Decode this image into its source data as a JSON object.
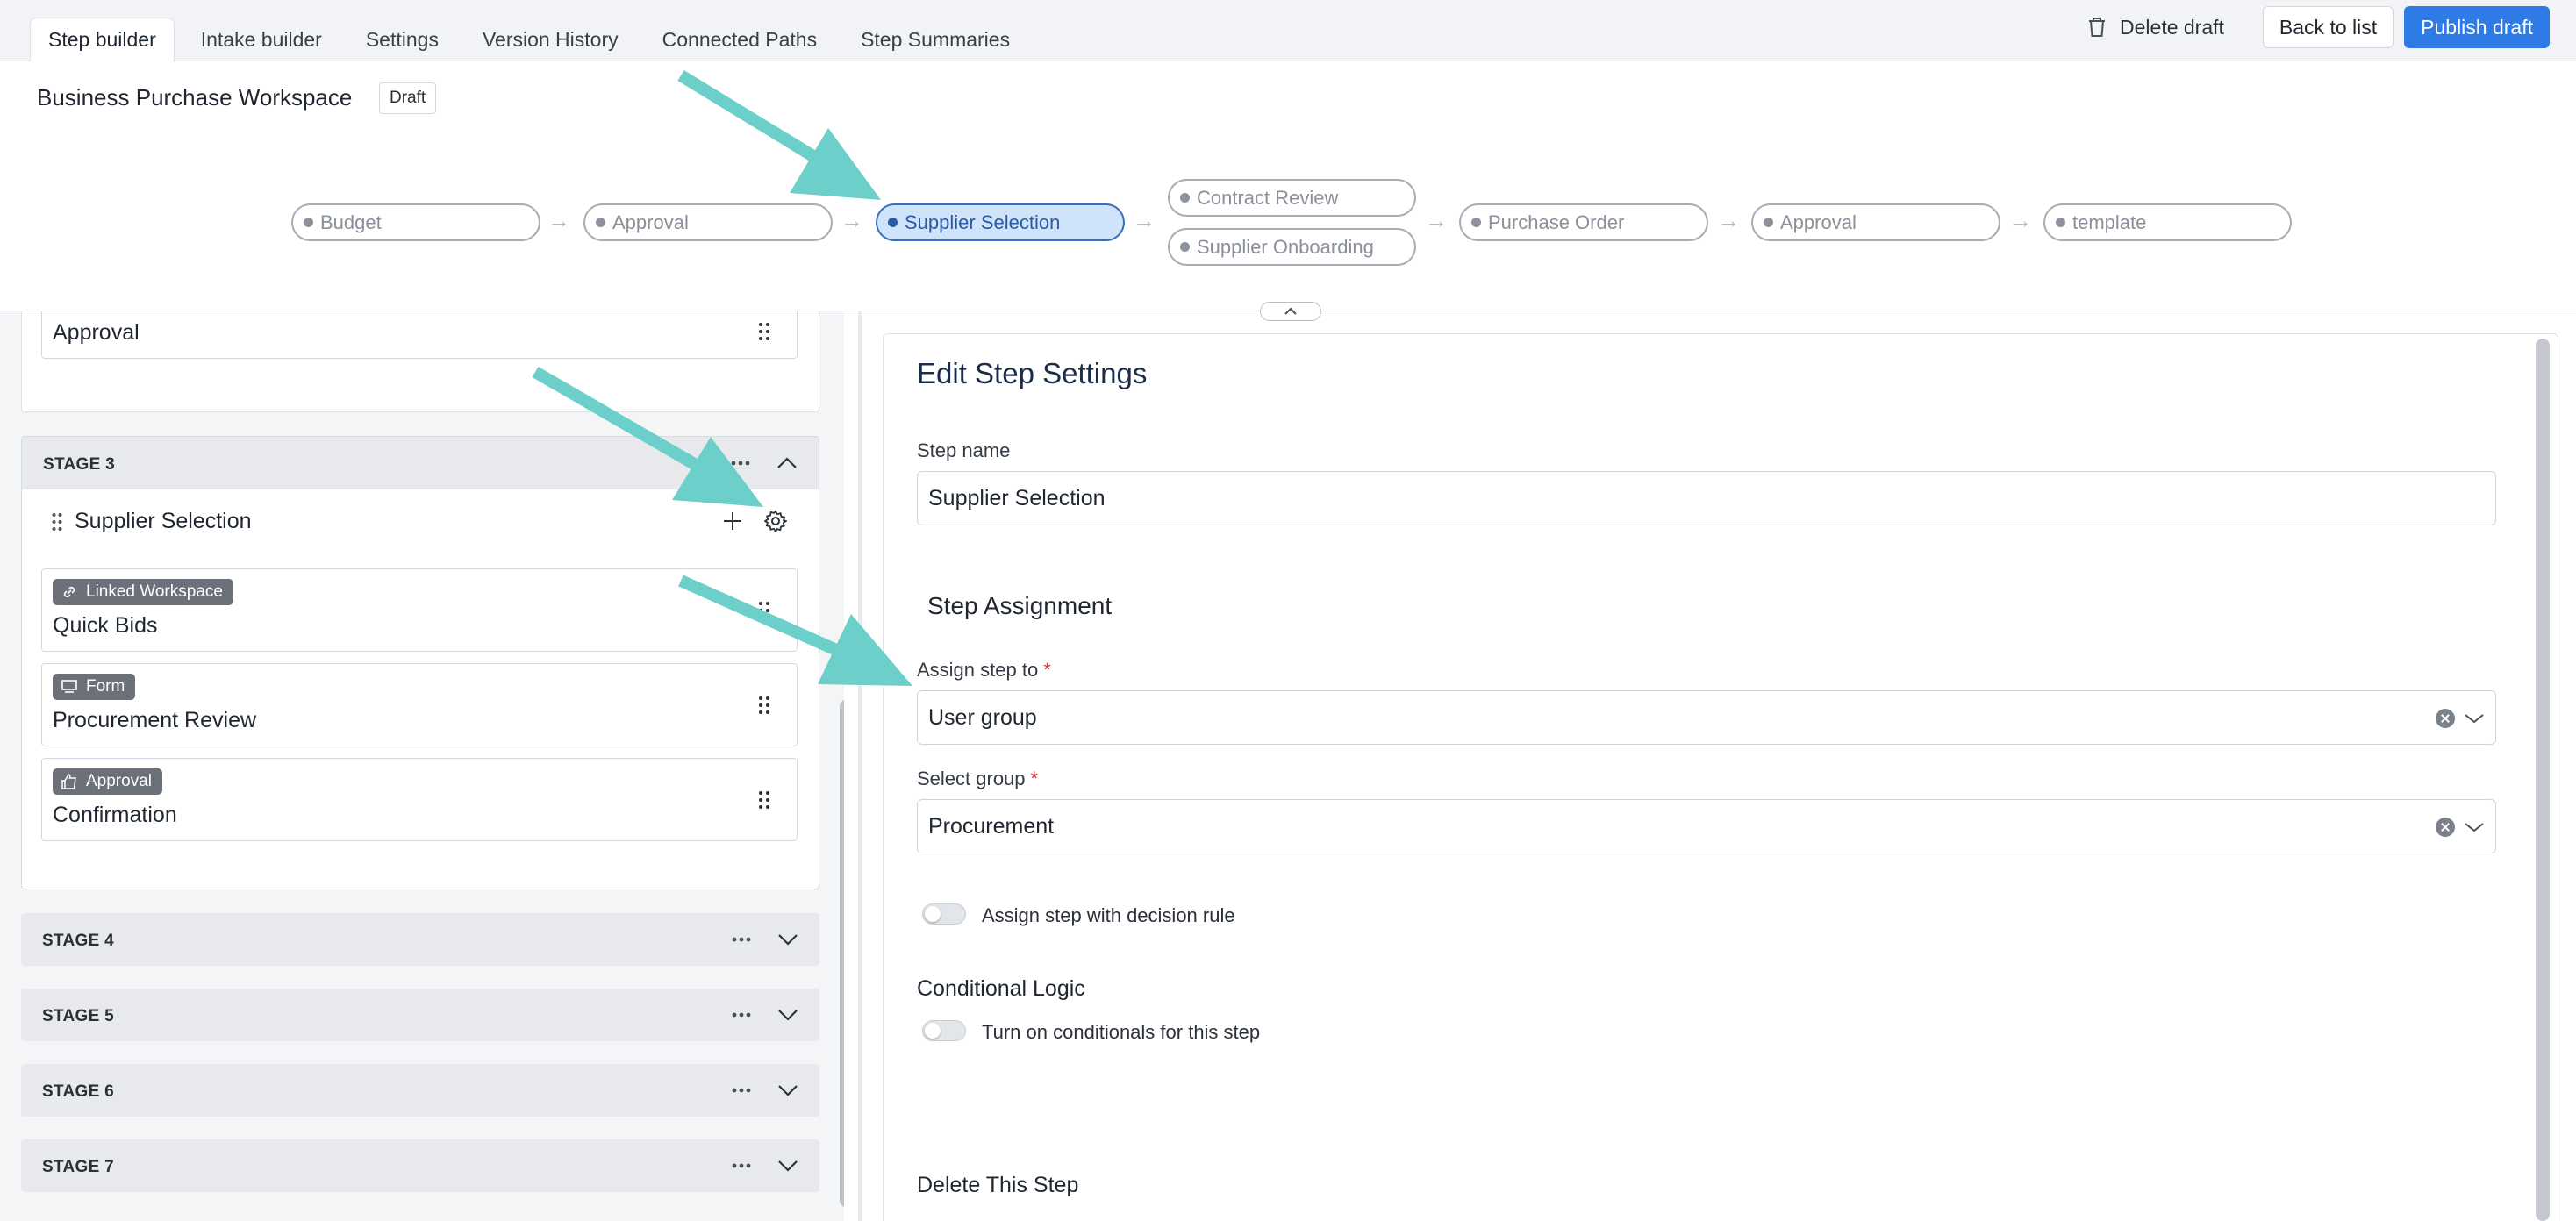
{
  "tabs": [
    {
      "label": "Step builder",
      "active": true
    },
    {
      "label": "Intake builder"
    },
    {
      "label": "Settings"
    },
    {
      "label": "Version History"
    },
    {
      "label": "Connected Paths"
    },
    {
      "label": "Step Summaries"
    }
  ],
  "actions": {
    "delete_draft": "Delete draft",
    "back_to_list": "Back to list",
    "publish_draft": "Publish draft"
  },
  "workspace": {
    "title": "Business Purchase Workspace",
    "status": "Draft"
  },
  "flow": {
    "nodes": [
      "Budget",
      "Approval",
      "Supplier Selection",
      "Contract Review",
      "Supplier Onboarding",
      "Purchase Order",
      "Approval",
      "template"
    ],
    "active_node": "Supplier Selection"
  },
  "left_panel": {
    "stage2_last_step": "Approval",
    "stage3": {
      "label": "STAGE 3",
      "step_group": "Supplier Selection",
      "steps": [
        {
          "type": "Linked Workspace",
          "title": "Quick Bids"
        },
        {
          "type": "Form",
          "title": "Procurement Review"
        },
        {
          "type": "Approval",
          "title": "Confirmation"
        }
      ]
    },
    "collapsed_stages": [
      "STAGE 4",
      "STAGE 5",
      "STAGE 6",
      "STAGE 7"
    ]
  },
  "edit_panel": {
    "title": "Edit Step Settings",
    "step_name_label": "Step name",
    "step_name_value": "Supplier Selection",
    "assignment_title": "Step Assignment",
    "assign_to_label": "Assign step to",
    "assign_to_value": "User group",
    "select_group_label": "Select group",
    "select_group_value": "Procurement",
    "required_mark": "*",
    "decision_rule_label": "Assign step with decision rule",
    "conditional_title": "Conditional Logic",
    "conditional_label": "Turn on conditionals for this step",
    "delete_title": "Delete This Step"
  },
  "colors": {
    "accent": "#2e7be6",
    "active_node_bg": "#cfe4fb",
    "annotation_arrow": "#6ccfc9"
  }
}
